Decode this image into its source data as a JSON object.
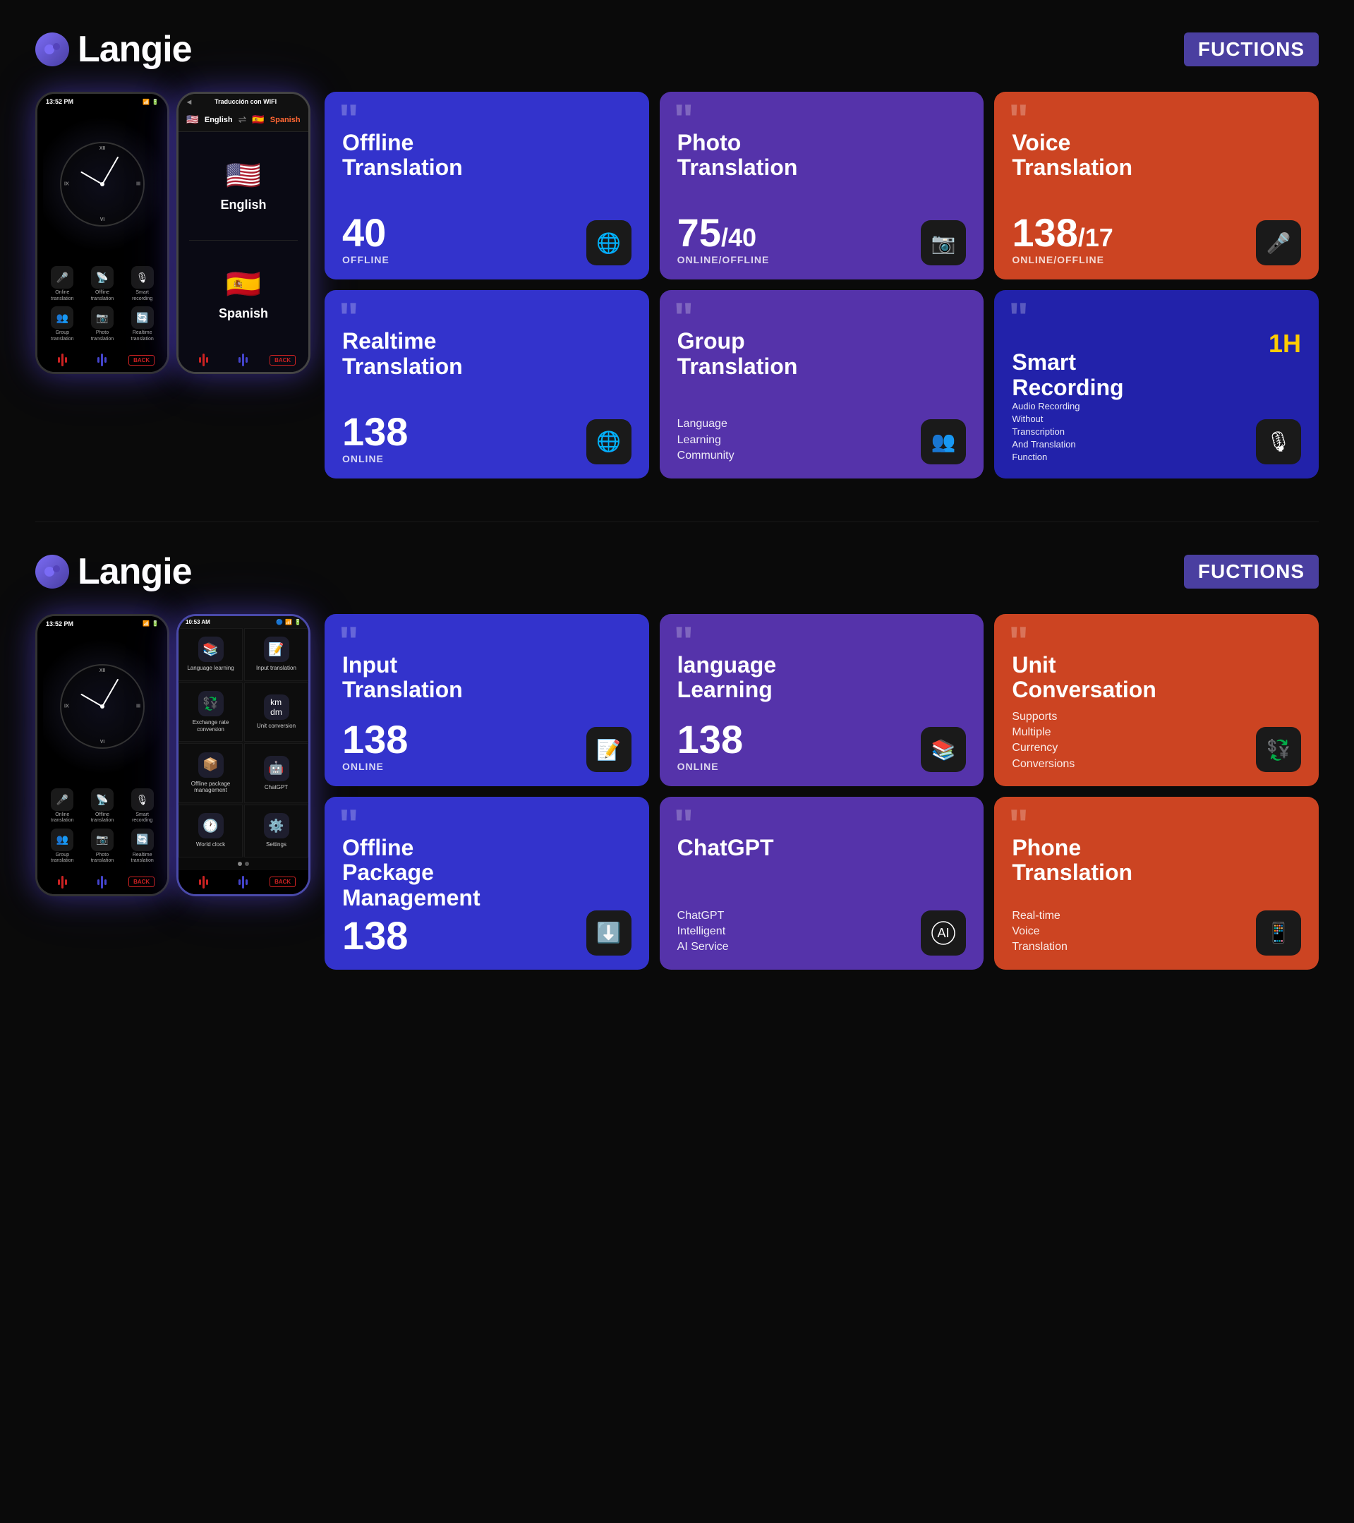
{
  "section1": {
    "logo_text": "Langie",
    "functions_badge": "FUCTIONS",
    "phone1": {
      "time": "13:52 PM",
      "nav_items": [
        {
          "icon": "🎤",
          "label": "Online\ntranslation"
        },
        {
          "icon": "📡",
          "label": "Offline\ntranslation"
        },
        {
          "icon": "🎙",
          "label": "Smart\nrecording"
        },
        {
          "icon": "👥",
          "label": "Group\ntranslation"
        },
        {
          "icon": "📷",
          "label": "Photo\ntranslation"
        },
        {
          "icon": "🔄",
          "label": "Realtime\ntranslation"
        }
      ]
    },
    "phone2": {
      "time": "",
      "header": "Traducción con WIFI",
      "lang1": "English",
      "lang2": "Spanish",
      "flag1": "🇺🇸",
      "flag2": "🇪🇸"
    },
    "cards": [
      {
        "title": "Offline\nTranslation",
        "count": "40",
        "count_suffix": "",
        "status": "OFFLINE",
        "icon": "🌐",
        "color": "card-blue"
      },
      {
        "title": "Photo\nTranslation",
        "count": "75",
        "count_suffix": "/40",
        "status": "ONLINE/OFFLINE",
        "icon": "📷",
        "color": "card-purple"
      },
      {
        "title": "Voice\nTranslation",
        "count": "138",
        "count_suffix": "/17",
        "status": "ONLINE/OFFLINE",
        "icon": "🎤",
        "color": "card-orange"
      },
      {
        "title": "Realtime\nTranslation",
        "count": "138",
        "count_suffix": "",
        "status": "ONLINE",
        "icon": "🌐",
        "color": "card-blue"
      },
      {
        "title": "Group\nTranslation",
        "desc": "Language\nLearning\nCommunity",
        "icon": "👥",
        "color": "card-purple"
      },
      {
        "title": "Smart\nRecording",
        "badge": "1H",
        "desc": "Audio Recording\nWithout\nTranscription\nAnd Translation\nFunction",
        "icon": "🎙",
        "color": "card-dark-blue"
      }
    ]
  },
  "section2": {
    "logo_text": "Langie",
    "functions_badge": "FUCTIONS",
    "phone1": {
      "time": "13:52 PM"
    },
    "phone2": {
      "time": "10:53 AM",
      "menu_items": [
        {
          "icon": "📚",
          "label": "Language learning"
        },
        {
          "icon": "📝",
          "label": "Input translation"
        },
        {
          "icon": "💱",
          "label": "Exchange rate\nconversion"
        },
        {
          "icon": "📏",
          "label": "Unit conversion"
        },
        {
          "icon": "📦",
          "label": "Offline package\nmanagement"
        },
        {
          "icon": "🤖",
          "label": "ChatGPT"
        },
        {
          "icon": "🕐",
          "label": "World clock"
        },
        {
          "icon": "⚙️",
          "label": "Settings"
        }
      ]
    },
    "cards": [
      {
        "title": "Input\nTranslation",
        "count": "138",
        "status": "ONLINE",
        "icon": "📝",
        "color": "card-blue"
      },
      {
        "title": "language\nLearning",
        "count": "138",
        "status": "ONLINE",
        "icon": "📚",
        "color": "card-purple"
      },
      {
        "title": "Unit\nConversation",
        "desc": "Supports\nMultiple\nCurrency\nConversions",
        "icon": "💱",
        "color": "card-orange"
      },
      {
        "title": "Offline\nPackage\nManagement",
        "count": "138",
        "status": "",
        "icon": "⬇️",
        "color": "card-blue"
      },
      {
        "title": "ChatGPT",
        "desc": "ChatGPT\nIntelligent\nAI Service",
        "icon": "🤖",
        "color": "card-purple"
      },
      {
        "title": "Phone\nTranslation",
        "desc": "Real-time\nVoice\nTranslation",
        "icon": "📱",
        "color": "card-orange"
      }
    ]
  }
}
